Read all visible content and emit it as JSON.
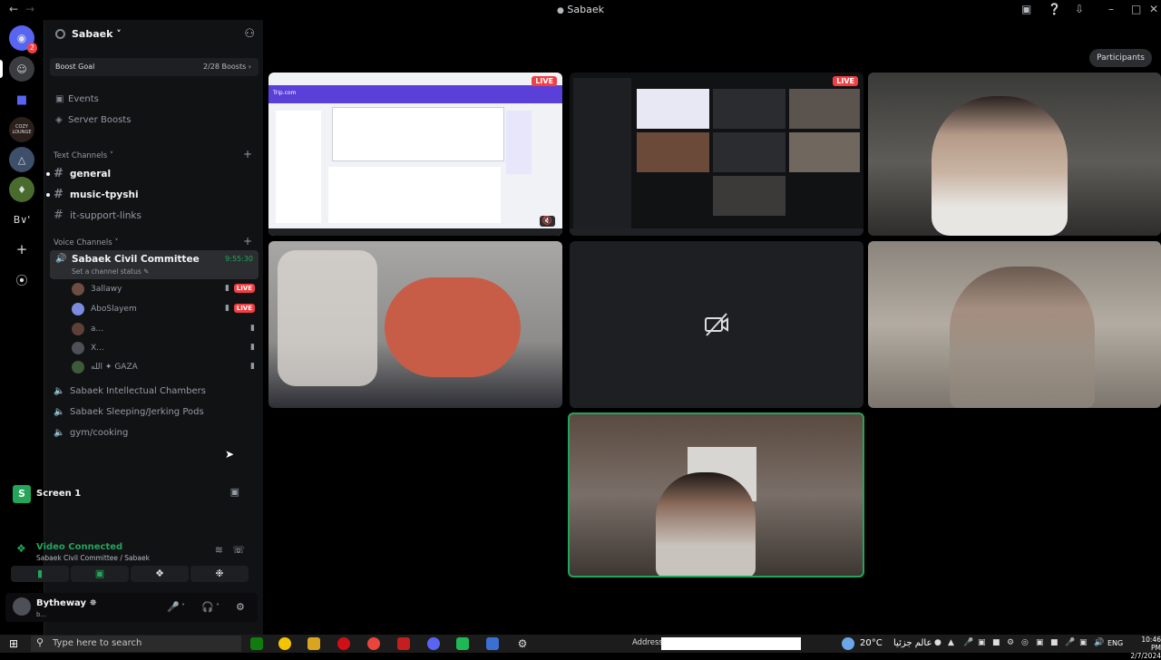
{
  "window": {
    "title": "Sabaek"
  },
  "server_rail": {
    "dm_badge": "2",
    "lounge_label": "COZY LOUNGE",
    "bv_label": "B∨'"
  },
  "guild": {
    "name": "Sabaek ˅",
    "boost_label": "Boost Goal",
    "boost_count": "2/28 Boosts ›"
  },
  "nav": {
    "events": "Events",
    "server_boosts": "Server Boosts"
  },
  "text_channels": {
    "category": "Text Channels ˅",
    "items": [
      {
        "name": "general",
        "bright": true
      },
      {
        "name": "music-tpyshi",
        "bright": true
      },
      {
        "name": "it-support-links",
        "bright": false
      }
    ]
  },
  "voice_channels": {
    "category": "Voice Channels ˅",
    "active": {
      "name": "Sabaek Civil Committee",
      "status": "Set a channel status ✎",
      "timer": "9:55:30"
    },
    "members": [
      {
        "name": "3allawy",
        "live": "LIVE"
      },
      {
        "name": "AboSlayem",
        "live": "LIVE"
      },
      {
        "name": "a..."
      },
      {
        "name": "X..."
      },
      {
        "name": "الله ✦ GAZA"
      }
    ],
    "others": [
      "Sabaek Intellectual Chambers",
      "Sabaek Sleeping/Jerking Pods",
      "gym/cooking"
    ]
  },
  "panel": {
    "screen_label": "Screen 1",
    "screen_initial": "S",
    "connected": "Video Connected",
    "connected_sub": "Sabaek Civil Committee / Sabaek",
    "user_name": "Bytheway ✵",
    "user_status": "b..."
  },
  "stage": {
    "participants_button": "Participants",
    "live_badge": "LIVE",
    "tile_tripcom": "Trip.com"
  },
  "taskbar": {
    "search_placeholder": "Type here to search",
    "address_label": "Address",
    "weather": "20°C",
    "arabic": "عالم جزئيا",
    "lang": "ENG",
    "time": "10:46 PM",
    "date": "2/7/2024"
  },
  "colors": {
    "accent_green": "#23a55a",
    "live_red": "#f23f43",
    "blurple": "#5865f2"
  }
}
